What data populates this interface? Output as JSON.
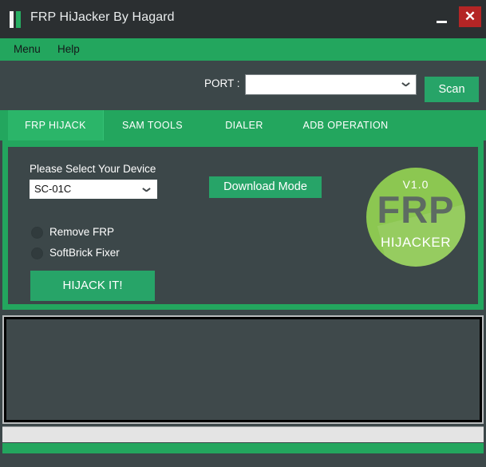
{
  "window": {
    "title": "FRP HiJacker By Hagard",
    "icon": "app-bars-icon",
    "minimize_label": "–",
    "close_label": "✕"
  },
  "menubar": {
    "items": [
      {
        "label": "Menu"
      },
      {
        "label": "Help"
      }
    ]
  },
  "port_row": {
    "label": "PORT :",
    "select_value": "",
    "select_placeholder": "",
    "scan_label": "Scan"
  },
  "tabs": [
    {
      "label": "FRP HIJACK",
      "active": true
    },
    {
      "label": "SAM TOOLS",
      "active": false
    },
    {
      "label": "DIALER",
      "active": false
    },
    {
      "label": "ADB OPERATION",
      "active": false
    }
  ],
  "frp_panel": {
    "device_label": "Please Select Your Device",
    "device_value": "SC-01C",
    "options": [
      {
        "label": "Remove FRP",
        "checked": false
      },
      {
        "label": "SoftBrick Fixer",
        "checked": false
      }
    ],
    "hijack_label": "HIJACK IT!",
    "download_mode_label": "Download Mode"
  },
  "logo": {
    "version": "V1.0",
    "main": "FRP",
    "sub": "HIJACKER"
  },
  "log": {
    "text": ""
  },
  "progress": {
    "percent": 0
  },
  "status": {
    "text": ""
  },
  "colors": {
    "brand_green": "#23a65e",
    "button_green": "#27a468",
    "tab_active_green": "#2bb569",
    "logo_green": "#8cc751",
    "panel_dark": "#3c4749",
    "titlebar_dark": "#2b2f31",
    "close_red": "#b42525"
  }
}
